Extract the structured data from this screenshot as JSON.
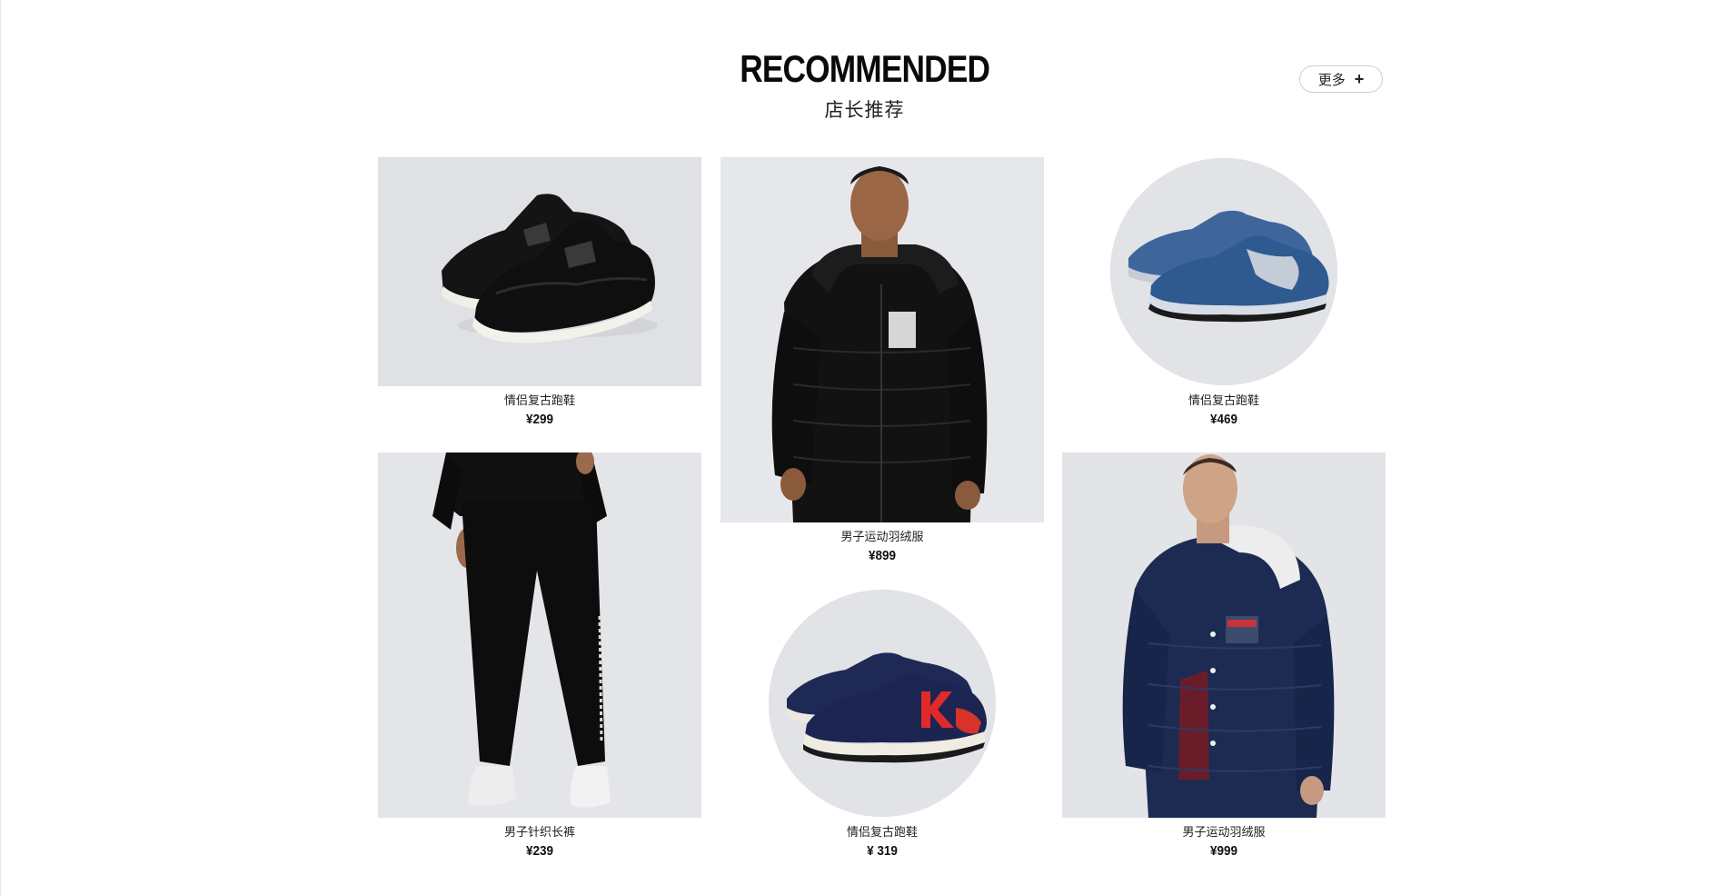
{
  "section": {
    "title": "RECOMMENDED",
    "subtitle": "店长推荐",
    "more_label": "更多",
    "more_icon": "plus-icon"
  },
  "products": [
    {
      "name": "情侣复古跑鞋",
      "price": "¥299",
      "image": "black-slip-on-sneakers"
    },
    {
      "name": "男子运动羽绒服",
      "price": "¥899",
      "image": "man-black-down-jacket"
    },
    {
      "name": "情侣复古跑鞋",
      "price": "¥469",
      "image": "blue-retro-running-shoes"
    },
    {
      "name": "男子针织长裤",
      "price": "¥239",
      "image": "black-knit-pants"
    },
    {
      "name": "情侣复古跑鞋",
      "price": "¥  319",
      "image": "navy-red-k-sneakers"
    },
    {
      "name": "男子运动羽绒服",
      "price": "¥999",
      "image": "man-navy-down-jacket"
    }
  ],
  "colors": {
    "image_bg": "#e4e6ea",
    "text": "#111111",
    "border": "#cfcfcf"
  }
}
